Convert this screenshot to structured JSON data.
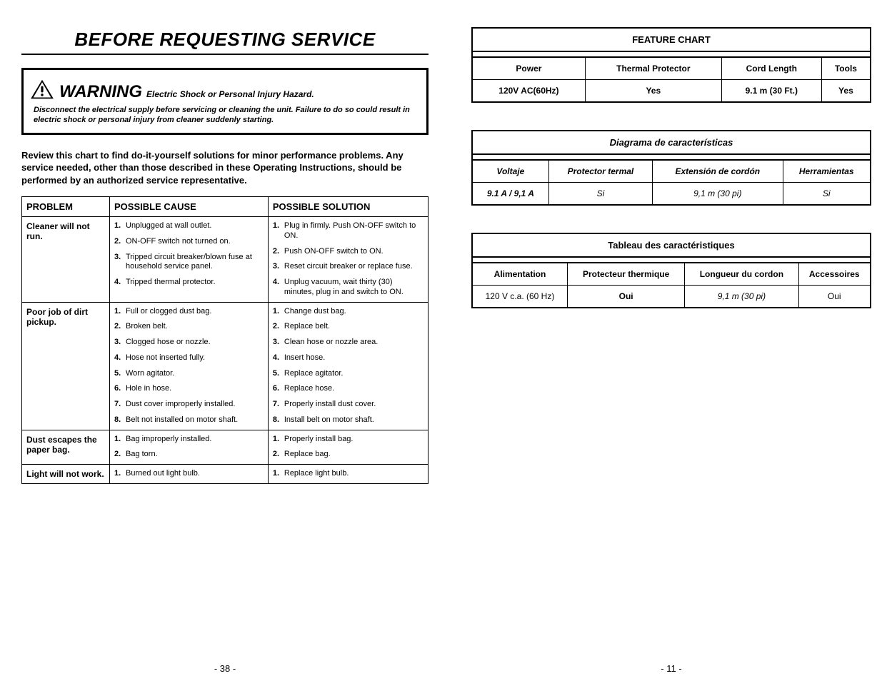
{
  "left": {
    "main_title": "BEFORE REQUESTING SERVICE",
    "warning_word": "WARNING",
    "warning_hazard": "Electric Shock or Personal Injury Hazard.",
    "warning_body": "Disconnect the electrical supply before servicing or cleaning the unit.  Failure to do so could result in electric shock or personal injury from cleaner suddenly starting.",
    "instructions": "Review this chart to find do-it-yourself solutions for minor performance problems. Any service needed, other than those described in these Operating Instructions, should be performed by an authorized service representative.",
    "headers": {
      "problem": "PROBLEM",
      "cause": "POSSIBLE CAUSE",
      "solution": "POSSIBLE SOLUTION"
    },
    "rows": [
      {
        "problem": "Cleaner will not run.",
        "causes": [
          "Unplugged at wall outlet.",
          "ON-OFF switch not turned on.",
          "Tripped circuit breaker/blown fuse at household service panel.",
          "Tripped thermal protector."
        ],
        "solutions": [
          "Plug in firmly. Push ON-OFF switch to ON.",
          "Push ON-OFF switch to ON.",
          "Reset circuit breaker or replace fuse.",
          "Unplug vacuum, wait thirty (30) minutes, plug in and switch to ON."
        ]
      },
      {
        "problem": "Poor job of dirt pickup.",
        "causes": [
          "Full or clogged dust bag.",
          "Broken belt.",
          "Clogged hose or nozzle.",
          "Hose not inserted fully.",
          "Worn agitator.",
          "Hole in hose.",
          "Dust cover improperly installed.",
          "Belt not installed on motor shaft."
        ],
        "solutions": [
          "Change dust bag.",
          "Replace belt.",
          "Clean hose or nozzle area.",
          "Insert hose.",
          "Replace agitator.",
          "Replace hose.",
          "Properly install dust cover.",
          "Install belt on motor shaft."
        ]
      },
      {
        "problem": "Dust escapes the paper bag.",
        "causes": [
          "Bag improperly installed.",
          "Bag torn."
        ],
        "solutions": [
          "Properly install bag.",
          "Replace bag."
        ]
      },
      {
        "problem": "Light will not work.",
        "causes": [
          "Burned out light bulb."
        ],
        "solutions": [
          "Replace light bulb."
        ]
      }
    ],
    "page": "- 38 -"
  },
  "right": {
    "feature_en": {
      "title": "FEATURE CHART",
      "heads": [
        "Power",
        "Thermal Protector",
        "Cord Length",
        "Tools"
      ],
      "data": [
        "120V AC(60Hz)",
        "Yes",
        "9.1 m (30 Ft.)",
        "Yes"
      ]
    },
    "feature_es": {
      "title": "Diagrama de características",
      "heads": [
        "Voltaje",
        "Protector termal",
        "Extensión de cordón",
        "Herramientas"
      ],
      "data": [
        "9.1 A / 9,1 A",
        "Si",
        "9,1 m (30 pi)",
        "Si"
      ]
    },
    "feature_fr": {
      "title": "Tableau des caractéristiques",
      "heads": [
        "Alimentation",
        "Protecteur thermique",
        "Longueur du cordon",
        "Accessoires"
      ],
      "data": [
        "120 V c.a. (60 Hz)",
        "Oui",
        "9,1 m (30 pi)",
        "Oui"
      ]
    },
    "page": "- 11 -"
  }
}
